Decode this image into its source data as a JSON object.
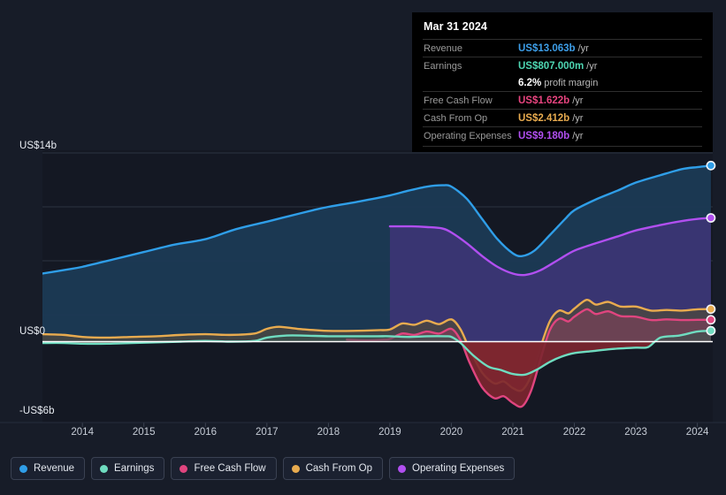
{
  "chart_data": {
    "type": "area",
    "title": "",
    "xlabel": "",
    "ylabel": "",
    "grid": true,
    "legend_position": "bottom-left",
    "ylim": [
      -6,
      14
    ],
    "y_ticks": [
      {
        "value": 14,
        "label": "US$14b"
      },
      {
        "value": 0,
        "label": "US$0"
      },
      {
        "value": -6,
        "label": "-US$6b"
      }
    ],
    "y_gridlines": [
      14,
      10,
      6,
      2,
      -6
    ],
    "x": [
      "2014",
      "2015",
      "2016",
      "2017",
      "2018",
      "2019",
      "2020",
      "2021",
      "2022",
      "2023",
      "2024"
    ],
    "xlim": [
      2013.35,
      2024.25
    ],
    "series": [
      {
        "name": "Revenue",
        "color": "#2f9ee8",
        "fill": "#1b3a55",
        "points": [
          [
            2013.35,
            5.05
          ],
          [
            2013.75,
            5.35
          ],
          [
            2014.0,
            5.55
          ],
          [
            2014.5,
            6.1
          ],
          [
            2015.0,
            6.65
          ],
          [
            2015.5,
            7.2
          ],
          [
            2016.0,
            7.6
          ],
          [
            2016.5,
            8.35
          ],
          [
            2017.0,
            8.9
          ],
          [
            2017.35,
            9.3
          ],
          [
            2017.75,
            9.75
          ],
          [
            2018.0,
            10.0
          ],
          [
            2018.5,
            10.4
          ],
          [
            2019.0,
            10.85
          ],
          [
            2019.3,
            11.2
          ],
          [
            2019.6,
            11.5
          ],
          [
            2019.85,
            11.6
          ],
          [
            2020.0,
            11.5
          ],
          [
            2020.25,
            10.6
          ],
          [
            2020.5,
            9.1
          ],
          [
            2020.75,
            7.6
          ],
          [
            2021.0,
            6.55
          ],
          [
            2021.15,
            6.35
          ],
          [
            2021.35,
            6.75
          ],
          [
            2021.6,
            7.9
          ],
          [
            2021.85,
            9.1
          ],
          [
            2022.0,
            9.75
          ],
          [
            2022.35,
            10.55
          ],
          [
            2022.7,
            11.2
          ],
          [
            2023.0,
            11.8
          ],
          [
            2023.4,
            12.35
          ],
          [
            2023.75,
            12.8
          ],
          [
            2024.0,
            12.95
          ],
          [
            2024.22,
            13.063
          ]
        ],
        "end_value": 13.063
      },
      {
        "name": "Operating Expenses",
        "color": "#b14ff0",
        "fill": "#41357a",
        "points": [
          [
            2019.0,
            8.55
          ],
          [
            2019.35,
            8.55
          ],
          [
            2019.6,
            8.5
          ],
          [
            2019.85,
            8.4
          ],
          [
            2020.0,
            8.1
          ],
          [
            2020.25,
            7.3
          ],
          [
            2020.5,
            6.35
          ],
          [
            2020.75,
            5.55
          ],
          [
            2021.0,
            5.05
          ],
          [
            2021.2,
            4.95
          ],
          [
            2021.45,
            5.3
          ],
          [
            2021.75,
            6.1
          ],
          [
            2022.0,
            6.75
          ],
          [
            2022.35,
            7.3
          ],
          [
            2022.7,
            7.8
          ],
          [
            2023.0,
            8.25
          ],
          [
            2023.4,
            8.65
          ],
          [
            2023.75,
            8.95
          ],
          [
            2024.0,
            9.1
          ],
          [
            2024.22,
            9.18
          ]
        ],
        "end_value": 9.18
      },
      {
        "name": "Cash From Op",
        "color": "#e8ab4f",
        "fill": "#4a4741",
        "points": [
          [
            2013.35,
            0.55
          ],
          [
            2013.7,
            0.5
          ],
          [
            2014.0,
            0.35
          ],
          [
            2014.4,
            0.3
          ],
          [
            2014.8,
            0.35
          ],
          [
            2015.2,
            0.4
          ],
          [
            2015.6,
            0.5
          ],
          [
            2016.0,
            0.55
          ],
          [
            2016.4,
            0.5
          ],
          [
            2016.8,
            0.6
          ],
          [
            2017.0,
            0.95
          ],
          [
            2017.2,
            1.1
          ],
          [
            2017.5,
            0.95
          ],
          [
            2017.8,
            0.85
          ],
          [
            2018.0,
            0.8
          ],
          [
            2018.4,
            0.8
          ],
          [
            2018.8,
            0.85
          ],
          [
            2019.0,
            0.9
          ],
          [
            2019.2,
            1.35
          ],
          [
            2019.4,
            1.25
          ],
          [
            2019.6,
            1.55
          ],
          [
            2019.8,
            1.3
          ],
          [
            2020.0,
            1.65
          ],
          [
            2020.15,
            0.9
          ],
          [
            2020.3,
            -0.6
          ],
          [
            2020.5,
            -2.3
          ],
          [
            2020.7,
            -3.1
          ],
          [
            2020.85,
            -2.95
          ],
          [
            2021.0,
            -3.45
          ],
          [
            2021.15,
            -3.6
          ],
          [
            2021.3,
            -2.5
          ],
          [
            2021.45,
            -0.4
          ],
          [
            2021.6,
            1.5
          ],
          [
            2021.75,
            2.3
          ],
          [
            2021.9,
            2.1
          ],
          [
            2022.0,
            2.45
          ],
          [
            2022.2,
            3.1
          ],
          [
            2022.35,
            2.75
          ],
          [
            2022.55,
            2.95
          ],
          [
            2022.75,
            2.6
          ],
          [
            2023.0,
            2.6
          ],
          [
            2023.25,
            2.3
          ],
          [
            2023.5,
            2.35
          ],
          [
            2023.75,
            2.3
          ],
          [
            2024.0,
            2.4
          ],
          [
            2024.22,
            2.412
          ]
        ],
        "end_value": 2.412
      },
      {
        "name": "Free Cash Flow",
        "color": "#e0457f",
        "fill": "#7a4258",
        "points": [
          [
            2018.3,
            0.15
          ],
          [
            2018.6,
            0.1
          ],
          [
            2018.9,
            0.15
          ],
          [
            2019.0,
            0.2
          ],
          [
            2019.2,
            0.6
          ],
          [
            2019.4,
            0.5
          ],
          [
            2019.6,
            0.75
          ],
          [
            2019.8,
            0.6
          ],
          [
            2020.0,
            0.95
          ],
          [
            2020.15,
            0.1
          ],
          [
            2020.3,
            -1.6
          ],
          [
            2020.5,
            -3.4
          ],
          [
            2020.7,
            -4.2
          ],
          [
            2020.85,
            -4.05
          ],
          [
            2021.0,
            -4.55
          ],
          [
            2021.15,
            -4.8
          ],
          [
            2021.3,
            -3.6
          ],
          [
            2021.45,
            -1.3
          ],
          [
            2021.6,
            0.85
          ],
          [
            2021.75,
            1.7
          ],
          [
            2021.9,
            1.5
          ],
          [
            2022.0,
            1.85
          ],
          [
            2022.2,
            2.4
          ],
          [
            2022.35,
            2.05
          ],
          [
            2022.55,
            2.25
          ],
          [
            2022.75,
            1.9
          ],
          [
            2023.0,
            1.85
          ],
          [
            2023.25,
            1.6
          ],
          [
            2023.5,
            1.65
          ],
          [
            2023.75,
            1.6
          ],
          [
            2024.0,
            1.62
          ],
          [
            2024.22,
            1.622
          ]
        ],
        "end_value": 1.622
      },
      {
        "name": "Earnings",
        "color": "#6fdcc0",
        "fill": "#35534f",
        "points": [
          [
            2013.35,
            -0.1
          ],
          [
            2013.7,
            -0.1
          ],
          [
            2014.0,
            -0.15
          ],
          [
            2014.4,
            -0.15
          ],
          [
            2014.8,
            -0.1
          ],
          [
            2015.2,
            -0.05
          ],
          [
            2015.6,
            0.0
          ],
          [
            2016.0,
            0.05
          ],
          [
            2016.4,
            0.0
          ],
          [
            2016.8,
            0.05
          ],
          [
            2017.0,
            0.3
          ],
          [
            2017.3,
            0.45
          ],
          [
            2017.6,
            0.45
          ],
          [
            2018.0,
            0.4
          ],
          [
            2018.4,
            0.4
          ],
          [
            2018.8,
            0.4
          ],
          [
            2019.0,
            0.4
          ],
          [
            2019.3,
            0.35
          ],
          [
            2019.6,
            0.4
          ],
          [
            2019.9,
            0.4
          ],
          [
            2020.0,
            0.35
          ],
          [
            2020.15,
            -0.1
          ],
          [
            2020.35,
            -1.0
          ],
          [
            2020.6,
            -1.85
          ],
          [
            2020.8,
            -2.1
          ],
          [
            2021.0,
            -2.4
          ],
          [
            2021.2,
            -2.45
          ],
          [
            2021.4,
            -2.05
          ],
          [
            2021.6,
            -1.5
          ],
          [
            2021.8,
            -1.1
          ],
          [
            2022.0,
            -0.85
          ],
          [
            2022.3,
            -0.7
          ],
          [
            2022.6,
            -0.55
          ],
          [
            2023.0,
            -0.45
          ],
          [
            2023.2,
            -0.4
          ],
          [
            2023.4,
            0.3
          ],
          [
            2023.7,
            0.45
          ],
          [
            2024.0,
            0.75
          ],
          [
            2024.22,
            0.807
          ]
        ],
        "end_value": 0.807
      }
    ]
  },
  "axis": {
    "y_top_label": "US$14b",
    "y_zero_label": "US$0",
    "y_bottom_label": "-US$6b",
    "x_labels": [
      "2014",
      "2015",
      "2016",
      "2017",
      "2018",
      "2019",
      "2020",
      "2021",
      "2022",
      "2023",
      "2024"
    ]
  },
  "tooltip": {
    "date": "Mar 31 2024",
    "rows": [
      {
        "label": "Revenue",
        "value": "US$13.063b",
        "unit": "/yr",
        "color": "#3d9ee8"
      },
      {
        "label": "Earnings",
        "value": "US$807.000m",
        "unit": "/yr",
        "color": "#4ed6b2"
      },
      {
        "label": "",
        "value": "6.2%",
        "unit": "profit margin",
        "color": "#ffffff"
      },
      {
        "label": "Free Cash Flow",
        "value": "US$1.622b",
        "unit": "/yr",
        "color": "#e8447f"
      },
      {
        "label": "Cash From Op",
        "value": "US$2.412b",
        "unit": "/yr",
        "color": "#e8ab4f"
      },
      {
        "label": "Operating Expenses",
        "value": "US$9.180b",
        "unit": "/yr",
        "color": "#b14ff0"
      }
    ]
  },
  "legend": {
    "items": [
      {
        "label": "Revenue",
        "color": "#2f9ee8"
      },
      {
        "label": "Earnings",
        "color": "#6fdcc0"
      },
      {
        "label": "Free Cash Flow",
        "color": "#e0457f"
      },
      {
        "label": "Cash From Op",
        "color": "#e8ab4f"
      },
      {
        "label": "Operating Expenses",
        "color": "#b14ff0"
      }
    ]
  },
  "colors": {
    "page_background": "#171c28",
    "plot_background": "#141823",
    "gridline": "#2c3342",
    "zero_line": "#ffffff",
    "negative_fill": "#7d2630",
    "tooltip_background": "#000000"
  }
}
